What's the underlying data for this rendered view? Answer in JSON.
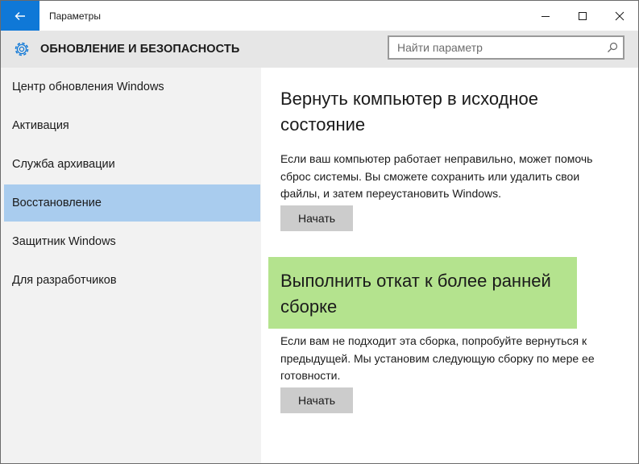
{
  "window": {
    "title": "Параметры"
  },
  "header": {
    "title": "ОБНОВЛЕНИЕ И БЕЗОПАСНОСТЬ"
  },
  "search": {
    "placeholder": "Найти параметр"
  },
  "sidebar": {
    "items": [
      {
        "label": "Центр обновления Windows"
      },
      {
        "label": "Активация"
      },
      {
        "label": "Служба архивации"
      },
      {
        "label": "Восстановление",
        "selected": true
      },
      {
        "label": "Защитник Windows"
      },
      {
        "label": "Для разработчиков"
      }
    ]
  },
  "main": {
    "sections": [
      {
        "title_line1": "Вернуть компьютер в исходное",
        "title_line2": "состояние",
        "desc_line1": "Если ваш компьютер работает неправильно, может помочь",
        "desc_line2": "сброс системы. Вы сможете сохранить или удалить свои",
        "desc_line3": "файлы, и затем переустановить Windows.",
        "button": "Начать"
      },
      {
        "title_line1": "Выполнить откат к более ранней",
        "title_line2": "сборке",
        "desc_line1": "Если вам не подходит эта сборка, попробуйте вернуться к",
        "desc_line2": "предыдущей. Мы установим следующую сборку по мере ее",
        "desc_line3": "готовности.",
        "button": "Начать",
        "highlighted": true
      }
    ]
  },
  "icons": {
    "back": "back-arrow-icon",
    "minimize": "minimize-icon",
    "maximize": "maximize-icon",
    "close": "close-icon",
    "settings": "gear-icon",
    "search": "search-icon"
  },
  "colors": {
    "accent": "#0f78d7",
    "header_band": "#e6e6e6",
    "sidebar_bg": "#f2f2f2",
    "selected_item": "#a9ccee",
    "highlight": "#b4e38e",
    "button_bg": "#cccccc"
  }
}
